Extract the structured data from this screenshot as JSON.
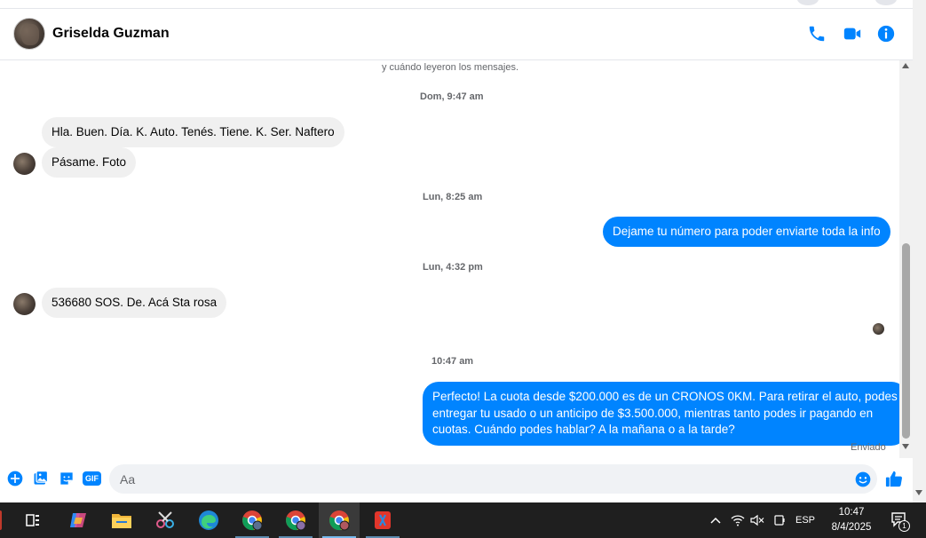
{
  "header": {
    "contact_name": "Griselda Guzman"
  },
  "chat": {
    "system_text": "y cuándo leyeron los mensajes.",
    "timestamps": [
      "Dom, 9:47 am",
      "Lun, 8:25 am",
      "Lun, 4:32 pm",
      "10:47 am"
    ],
    "messages": [
      {
        "direction": "in",
        "text": "Hla. Buen. Día. K. Auto. Tenés. Tiene. K. Ser. Naftero"
      },
      {
        "direction": "in",
        "text": "Pásame. Foto"
      },
      {
        "direction": "out",
        "text": "Dejame tu número para poder enviarte toda la info"
      },
      {
        "direction": "in",
        "text": "536680  SOS. De. Acá Sta rosa"
      },
      {
        "direction": "out",
        "lines": [
          "Perfecto! La cuota desde $200.000 es de un CRONOS 0KM. Para retirar el auto, podes",
          "entregar tu usado o un anticipo de $3.500.000, mientras tanto podes ir pagando en",
          "cuotas. Cuándo podes hablar? A la mañana o a la tarde?"
        ]
      }
    ],
    "status": "Enviado"
  },
  "composer": {
    "placeholder": "Aa",
    "gif_label": "GIF"
  },
  "taskbar": {
    "language": "ESP",
    "time": "10:47",
    "date": "8/4/2025",
    "notification_count": "1"
  },
  "colors": {
    "accent": "#0084ff",
    "incoming_bubble": "#f0f0f0",
    "taskbar": "#1f1f1f"
  }
}
